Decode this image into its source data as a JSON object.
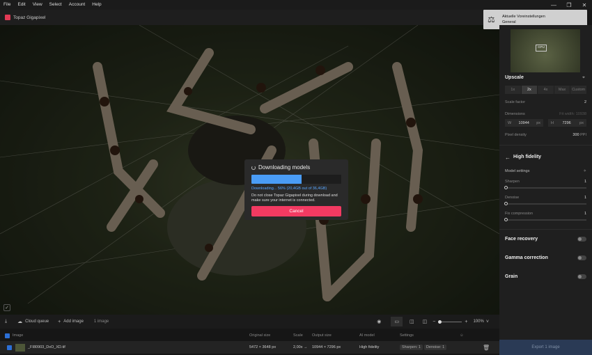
{
  "menu": [
    "File",
    "Edit",
    "View",
    "Select",
    "Account",
    "Help"
  ],
  "window": {
    "title": "Topaz Gigapixel"
  },
  "toast": {
    "title": "Aktuelle Voreinstellungen",
    "subtitle": "General"
  },
  "dialog": {
    "title": "Downloading models",
    "progress_fraction": 0.56,
    "progress_text": "Downloading... 56% (20,4GB out of 36,4GB)",
    "warning": "Do not close Topaz Gigapixel during download and make sure your internet is connected.",
    "cancel_label": "Cancel"
  },
  "side": {
    "preview_label": "GPU",
    "upscale_title": "Upscale",
    "scales": [
      "1x",
      "2x",
      "4x",
      "Max",
      "Custom"
    ],
    "selected_scale": "2x",
    "scale_factor_label": "Scale factor",
    "scale_factor_value": "2",
    "dimensions_label": "Dimensions",
    "dimensions_hint": "Fit width: 10938",
    "w_label": "W",
    "w_value": "10944",
    "w_unit": "px",
    "h_label": "H",
    "h_value": "7296",
    "h_unit": "px",
    "density_label": "Pixel density",
    "density_value": "300",
    "density_unit": "PPI",
    "model_title": "High fidelity",
    "model_settings_label": "Model settings",
    "sliders": [
      {
        "label": "Sharpen",
        "value": "1"
      },
      {
        "label": "Denoise",
        "value": "1"
      },
      {
        "label": "Fix compression",
        "value": "1"
      }
    ],
    "toggles": [
      "Face recovery",
      "Gamma correction",
      "Grain"
    ]
  },
  "bottom": {
    "cloud_queue": "Cloud queue",
    "add_image": "Add image",
    "count": "1 image",
    "zoom": "100%"
  },
  "table": {
    "headers": [
      "Image",
      "Original size",
      "Scale",
      "Output size",
      "AI model",
      "Settings"
    ],
    "row": {
      "filename": "_FI80903_DxO_XD.tif",
      "original": "5472 × 3648 px",
      "scale": "2,00x →",
      "output": "10944 × 7296 px",
      "model": "High fidelity",
      "sharpen": "Sharpen: 1",
      "denoise": "Denoise: 1"
    }
  },
  "export_label": "Export 1 image"
}
